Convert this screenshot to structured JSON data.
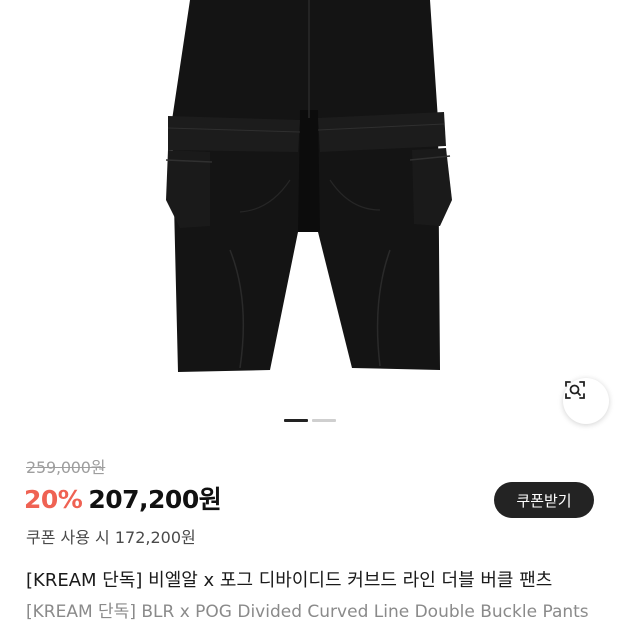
{
  "product": {
    "original_price": "259,000원",
    "discount": "20%",
    "sale_price": "207,200원",
    "coupon_button_label": "쿠폰받기",
    "coupon_price_text": "쿠폰 사용 시 172,200원",
    "title_ko": "[KREAM 단독] 비엘알 x 포그 디바이디드 커브드 라인 더블 버클 팬츠",
    "title_en": "[KREAM 단독] BLR x POG Divided Curved Line Double Buckle Pants"
  },
  "gallery": {
    "indicators": [
      {
        "active": true
      },
      {
        "active": false
      }
    ],
    "lens_icon": "image-search-icon"
  },
  "colors": {
    "discount": "#ef6253",
    "button_bg": "#232323",
    "pants": "#141414"
  }
}
